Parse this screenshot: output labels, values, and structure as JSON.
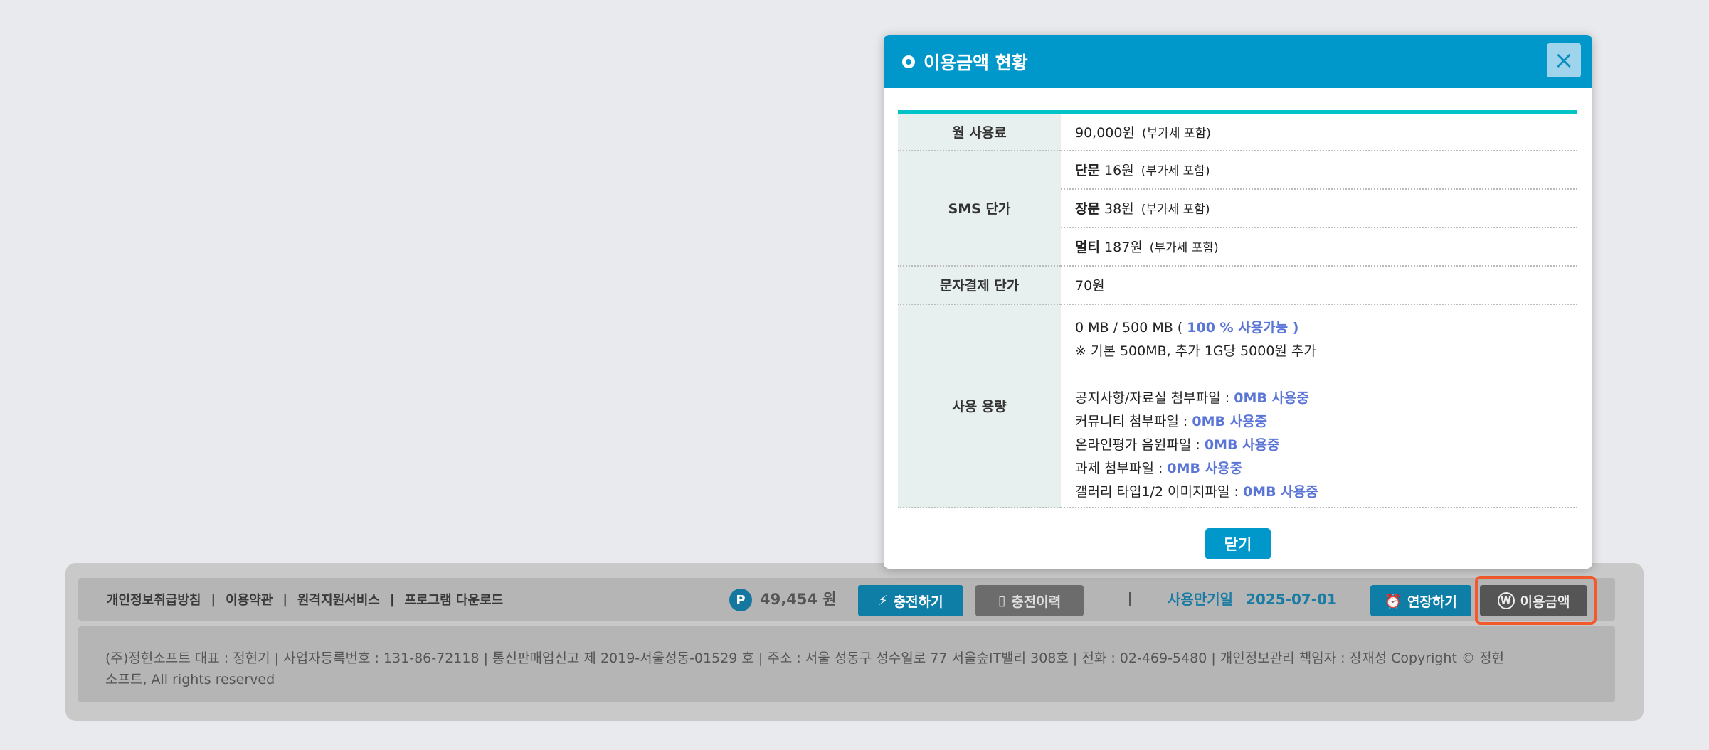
{
  "modal": {
    "title": "이용금액 현황",
    "close_icon": "×",
    "ok_label": "닫기",
    "rows": {
      "monthly": {
        "label": "월 사용료",
        "value": "90,000원",
        "note": "(부가세 포함)"
      },
      "sms": {
        "label": "SMS 단가",
        "items": [
          {
            "type": "단문",
            "price": "16원",
            "note": "(부가세 포함)"
          },
          {
            "type": "장문",
            "price": "38원",
            "note": "(부가세 포함)"
          },
          {
            "type": "멀티",
            "price": "187원",
            "note": "(부가세 포함)"
          }
        ]
      },
      "payment": {
        "label": "문자결제 단가",
        "value": "70원"
      },
      "storage": {
        "label": "사용 용량",
        "usage": "0 MB / 500 MB (",
        "usage_hl": "100 % 사용가능 )",
        "policy": "※ 기본 500MB, 추가 1G당 5000원 추가",
        "items": [
          {
            "label": "공지사항/자료실 첨부파일 :",
            "value": "0MB 사용중"
          },
          {
            "label": "커뮤니티 첨부파일 :",
            "value": "0MB 사용중"
          },
          {
            "label": "온라인평가 음원파일 :",
            "value": "0MB 사용중"
          },
          {
            "label": "과제 첨부파일 :",
            "value": "0MB 사용중"
          },
          {
            "label": "갤러리 타입1/2 이미지파일 :",
            "value": "0MB 사용중"
          }
        ]
      }
    }
  },
  "footer": {
    "links": [
      "개인정보취급방침",
      "이용약관",
      "원격지원서비스",
      "프로그램 다운로드"
    ],
    "point_icon": "P",
    "points": "49,454 원",
    "charge": "충전하기",
    "history": "충전이력",
    "expiry_label": "사용만기일",
    "expiry_date": "2025-07-01",
    "extend": "연장하기",
    "usage": "이용금액",
    "company_line1": "(주)정현소프트 대표 : 정현기 | 사업자등록번호 : 131-86-72118 | 통신판매업신고 제 2019-서울성동-01529 호 | 주소 : 서울 성동구 성수일로 77 서울숲IT밸리 308호 | 전화 : 02-469-5480 | 개인정보관리 책임자 : 장재성 Copyright © 정현",
    "company_line2": "소프트, All rights reserved"
  },
  "colors": {
    "accent": "#0098cb",
    "highlight": "#5a75d6",
    "outline": "#f25a2c"
  }
}
